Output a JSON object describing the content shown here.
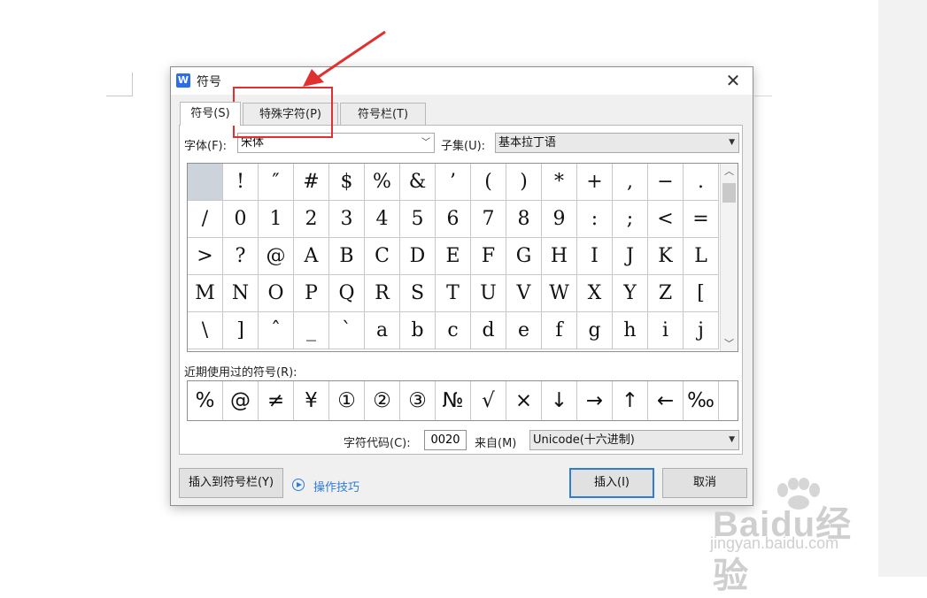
{
  "dialog": {
    "title": "符号",
    "app_icon_letter": "W",
    "close_symbol": "✕"
  },
  "tabs": [
    {
      "label": "符号(S)",
      "active": true
    },
    {
      "label": "特殊字符(P)",
      "active": false
    },
    {
      "label": "符号栏(T)",
      "active": false
    }
  ],
  "font": {
    "label": "字体(F):",
    "value": "宋体"
  },
  "subset": {
    "label": "子集(U):",
    "value": "基本拉丁语"
  },
  "symbols": {
    "selected_index": 0,
    "rows": [
      [
        " ",
        "!",
        "″",
        "#",
        "$",
        "%",
        "&",
        "’",
        "(",
        ")",
        "*",
        "+",
        ",",
        "−",
        "."
      ],
      [
        "/",
        "0",
        "1",
        "2",
        "3",
        "4",
        "5",
        "6",
        "7",
        "8",
        "9",
        ":",
        ";",
        "<",
        "="
      ],
      [
        ">",
        "?",
        "@",
        "A",
        "B",
        "C",
        "D",
        "E",
        "F",
        "G",
        "H",
        "I",
        "J",
        "K",
        "L"
      ],
      [
        "M",
        "N",
        "O",
        "P",
        "Q",
        "R",
        "S",
        "T",
        "U",
        "V",
        "W",
        "X",
        "Y",
        "Z",
        "["
      ],
      [
        "\\",
        "]",
        "ˆ",
        "_",
        "`",
        "a",
        "b",
        "c",
        "d",
        "e",
        "f",
        "g",
        "h",
        "i",
        "j"
      ]
    ]
  },
  "recent": {
    "label": "近期使用过的符号(R):",
    "items": [
      "%",
      "@",
      "≠",
      "¥",
      "①",
      "②",
      "③",
      "№",
      "√",
      "×",
      "↓",
      "→",
      "↑",
      "←",
      "‰"
    ]
  },
  "char_code": {
    "label": "字符代码(C):",
    "value": "0020"
  },
  "from": {
    "label": "来自(M)",
    "value": "Unicode(十六进制)"
  },
  "buttons": {
    "insert_to_bar": "插入到符号栏(Y)",
    "tips": "操作技巧",
    "insert": "插入(I)",
    "cancel": "取消"
  },
  "watermark": {
    "brand": "Baidu经验",
    "url": "jingyan.baidu.com"
  },
  "colors": {
    "annotation": "#e03030",
    "link": "#2f7bd8",
    "selected_cell": "#ccd3db"
  }
}
